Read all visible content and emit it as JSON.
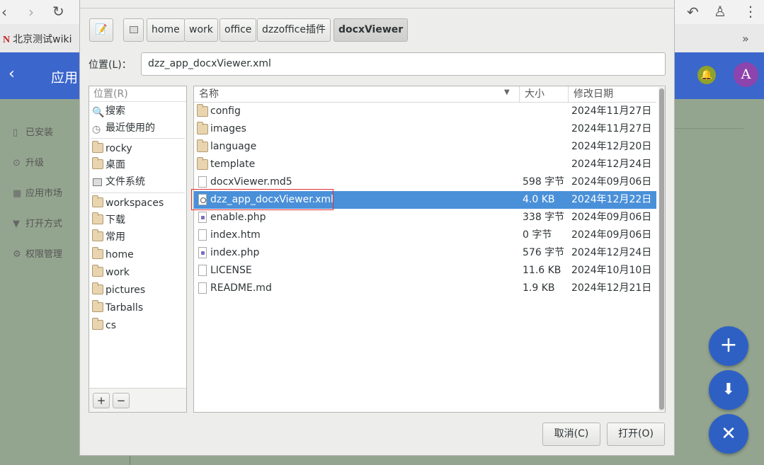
{
  "browser": {
    "bookmark": "北京测试wiki",
    "bookmark_logo": "N",
    "more": "»"
  },
  "app": {
    "title": "应用",
    "avatar_letter": "A",
    "sidebar": [
      {
        "label": "已安装",
        "icon": "file-icon"
      },
      {
        "label": "升级",
        "icon": "upgrade-icon"
      },
      {
        "label": "应用市场",
        "icon": "grid-icon"
      },
      {
        "label": "打开方式",
        "icon": "filter-icon"
      },
      {
        "label": "权限管理",
        "icon": "gear-icon"
      }
    ],
    "fab_colors": {
      "background": "#2e60c4"
    }
  },
  "dialog": {
    "breadcrumbs": [
      "home",
      "work",
      "office",
      "dzzoffice插件",
      "docxViewer"
    ],
    "active_crumb": "docxViewer",
    "location_label": "位置(L)：",
    "location_value": "dzz_app_docxViewer.xml",
    "places_header": "位置(R)",
    "places": [
      {
        "label": "搜索",
        "icon": "search-icon"
      },
      {
        "label": "最近使用的",
        "icon": "recent-icon"
      },
      {
        "label": "rocky",
        "icon": "home-folder-icon"
      },
      {
        "label": "桌面",
        "icon": "desktop-folder-icon"
      },
      {
        "label": "文件系统",
        "icon": "drive-icon"
      },
      {
        "label": "workspaces",
        "icon": "folder-icon"
      },
      {
        "label": "下载",
        "icon": "folder-icon"
      },
      {
        "label": "常用",
        "icon": "folder-icon"
      },
      {
        "label": "home",
        "icon": "folder-icon"
      },
      {
        "label": "work",
        "icon": "folder-icon"
      },
      {
        "label": "pictures",
        "icon": "folder-icon"
      },
      {
        "label": "Tarballs",
        "icon": "folder-icon"
      },
      {
        "label": "cs",
        "icon": "folder-icon"
      }
    ],
    "add_place": "+",
    "remove_place": "−",
    "columns": {
      "name": "名称",
      "size": "大小",
      "modified": "修改日期"
    },
    "files": [
      {
        "name": "config",
        "size": "",
        "date": "2024年11月27日",
        "type": "folder"
      },
      {
        "name": "images",
        "size": "",
        "date": "2024年11月27日",
        "type": "folder"
      },
      {
        "name": "language",
        "size": "",
        "date": "2024年12月20日",
        "type": "folder"
      },
      {
        "name": "template",
        "size": "",
        "date": "2024年12月24日",
        "type": "folder"
      },
      {
        "name": "docxViewer.md5",
        "size": "598 字节",
        "date": "2024年09月06日",
        "type": "text"
      },
      {
        "name": "dzz_app_docxViewer.xml",
        "size": "4.0 KB",
        "date": "2024年12月22日",
        "type": "xml",
        "selected": true
      },
      {
        "name": "enable.php",
        "size": "338 字节",
        "date": "2024年09月06日",
        "type": "php"
      },
      {
        "name": "index.htm",
        "size": "0 字节",
        "date": "2024年09月06日",
        "type": "text"
      },
      {
        "name": "index.php",
        "size": "576 字节",
        "date": "2024年12月24日",
        "type": "php"
      },
      {
        "name": "LICENSE",
        "size": "11.6 KB",
        "date": "2024年10月10日",
        "type": "text"
      },
      {
        "name": "README.md",
        "size": "1.9 KB",
        "date": "2024年12月21日",
        "type": "text"
      }
    ],
    "cancel": "取消(C)",
    "open": "打开(O)",
    "selection_color": "#4a90d9",
    "highlight_box_color": "#e03030"
  }
}
